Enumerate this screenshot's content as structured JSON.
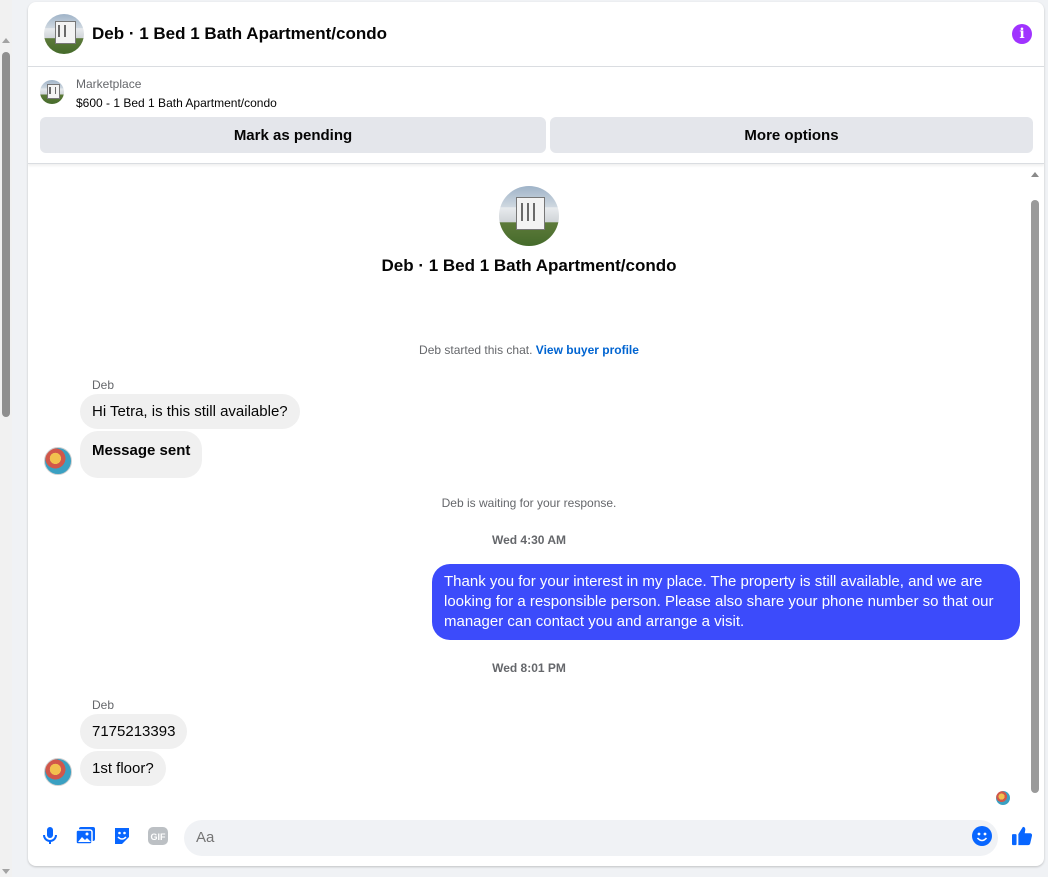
{
  "header": {
    "title": "Deb · 1 Bed 1 Bath Apartment/condo",
    "info_icon": "info-icon",
    "accent": "#a033ff"
  },
  "marketplace": {
    "label": "Marketplace",
    "listing": "$600 - 1 Bed 1 Bath Apartment/condo",
    "buttons": {
      "pending": "Mark as pending",
      "more": "More options"
    }
  },
  "chat": {
    "profile_name": "Deb · 1 Bed 1 Bath Apartment/condo",
    "started_text": "Deb started this chat.",
    "view_profile_link": "View buyer profile",
    "group1": {
      "sender": "Deb",
      "messages": [
        "Hi Tetra, is this still available?",
        "Message sent"
      ]
    },
    "waiting_text": "Deb is waiting for your response.",
    "time1": "Wed 4:30 AM",
    "my_message": "Thank you for your interest in my place. The property is still available, and we are looking for a responsible person. Please also share your phone number so that our manager can contact you and arrange a visit.",
    "my_bubble_color": "#3c4bfb",
    "time2": "Wed 8:01 PM",
    "group2": {
      "sender": "Deb",
      "messages": [
        "7175213393",
        "1st floor?"
      ]
    }
  },
  "composer": {
    "placeholder": "Aa",
    "icons": [
      "microphone-icon",
      "photo-icon",
      "sticker-icon",
      "gif-icon",
      "emoji-icon",
      "like-icon"
    ],
    "gif_label": "GIF"
  }
}
